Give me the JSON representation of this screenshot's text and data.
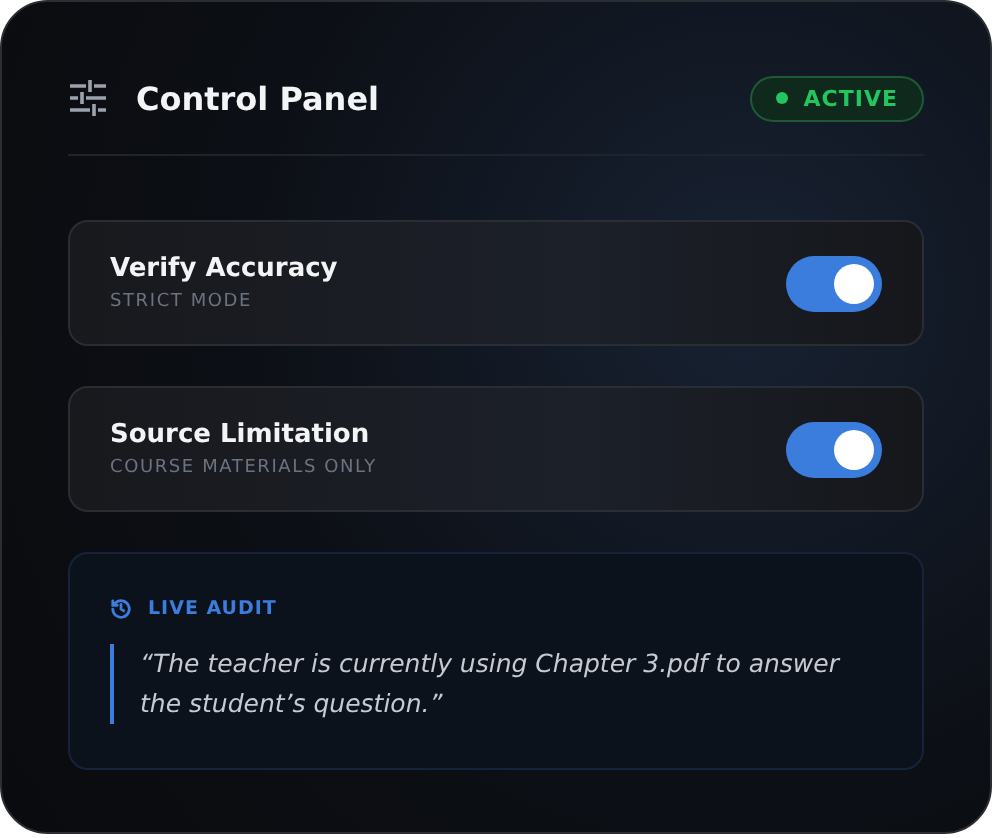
{
  "header": {
    "title": "Control Panel",
    "status": {
      "label": "ACTIVE",
      "color": "#22c55e"
    }
  },
  "settings": [
    {
      "title": "Verify Accuracy",
      "subtitle": "STRICT MODE",
      "on": true
    },
    {
      "title": "Source Limitation",
      "subtitle": "COURSE MATERIALS ONLY",
      "on": true
    }
  ],
  "audit": {
    "label": "LIVE AUDIT",
    "quote": "“The teacher is currently using Chapter 3.pdf to answer the student’s question.”"
  }
}
